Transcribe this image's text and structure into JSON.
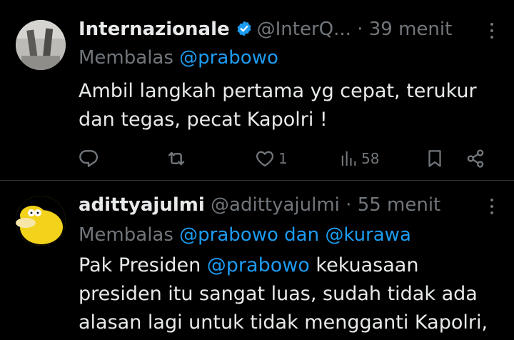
{
  "tweets": [
    {
      "name": "Internazionale",
      "handle": "@InterQ...",
      "sep": "·",
      "time": "39 menit",
      "reply_prefix": "Membalas",
      "reply_to": "@prabowo",
      "text_line1": "Ambil langkah pertama yg cepat, terukur",
      "text_line2": "dan tegas, pecat Kapolri !",
      "likes": "1",
      "views": "58",
      "verified": true
    },
    {
      "name": "adittyajulmi",
      "handle": "@adittyajulmi",
      "sep": "·",
      "time": "55 menit",
      "reply_prefix": "Membalas",
      "reply_to": "@prabowo dan @kurawa",
      "text_line1_a": "Pak Presiden ",
      "text_line1_mention": "@prabowo",
      "text_line1_b": " kekuasaan",
      "text_line2": "presiden itu sangat luas, sudah tidak ada",
      "text_line3": "alasan lagi untuk tidak mengganti Kapolri,"
    }
  ],
  "colors": {
    "background": "#000000",
    "text": "#e7e9ea",
    "muted": "#71767b",
    "link": "#1d9bf0",
    "divider": "#2f3336"
  }
}
